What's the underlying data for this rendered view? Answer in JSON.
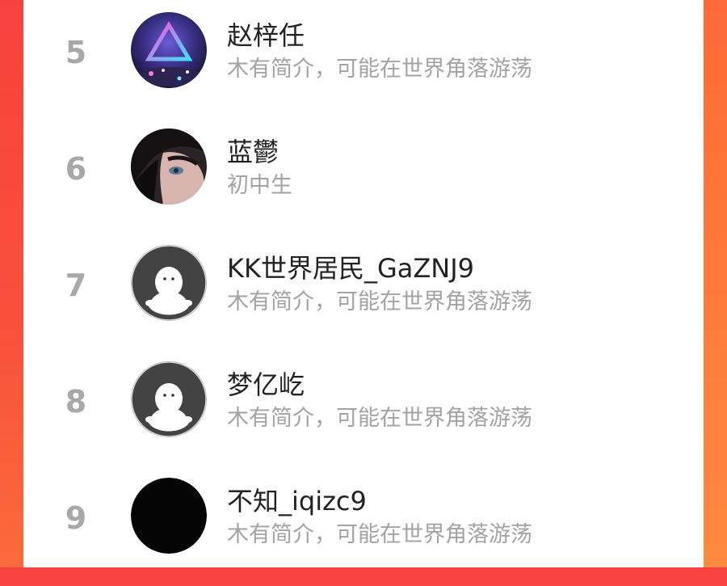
{
  "ranking": {
    "items": [
      {
        "rank": "5",
        "name": "赵梓任",
        "bio": "木有简介，可能在世界角落游荡",
        "avatar": "neon-triangle-avatar"
      },
      {
        "rank": "6",
        "name": "蓝鬱",
        "bio": "初中生",
        "avatar": "anime-boy-avatar"
      },
      {
        "rank": "7",
        "name": "KK世界居民_GaZNJ9",
        "bio": "木有简介，可能在世界角落游荡",
        "avatar": "default-person-avatar"
      },
      {
        "rank": "8",
        "name": "梦亿屹",
        "bio": "木有简介，可能在世界角落游荡",
        "avatar": "default-person-avatar"
      },
      {
        "rank": "9",
        "name": "不知_iqizc9",
        "bio": "木有简介，可能在世界角落游荡",
        "avatar": "black-circle-avatar"
      }
    ]
  },
  "colors": {
    "background_top": "#f9423f",
    "background_bottom": "#ff8a3e",
    "card": "#ffffff",
    "rank_text": "#a8a8a8",
    "name_text": "#222222",
    "bio_text": "#a3a3a3"
  }
}
